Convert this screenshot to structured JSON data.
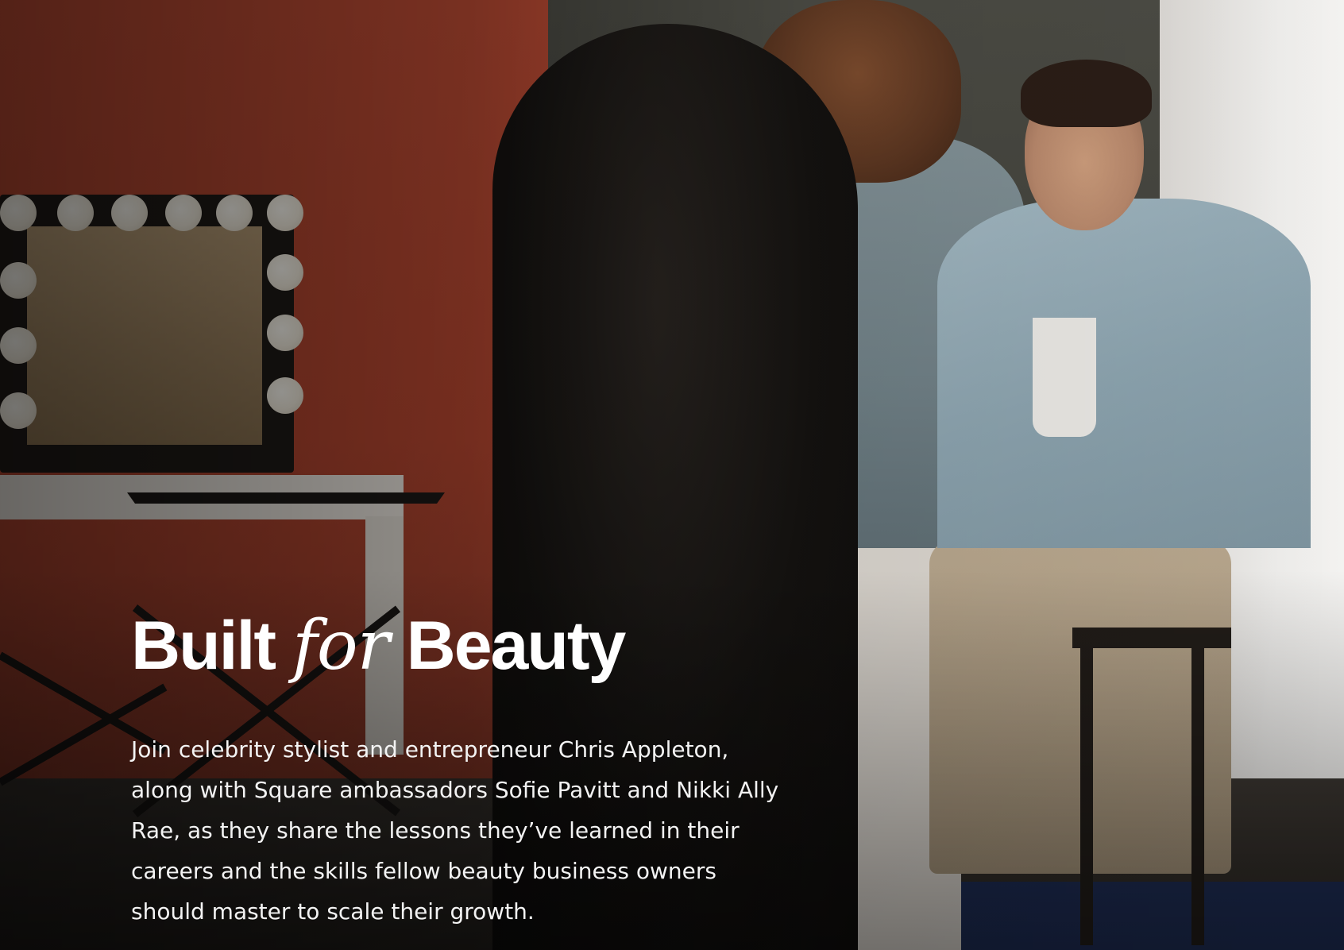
{
  "hero": {
    "headline_part1": "Built",
    "headline_part2": "for",
    "headline_part3": "Beauty",
    "body": "Join celebrity stylist and entrepreneur Chris Appleton, along with Square ambassadors Sofie Pavitt and Nikki Ally Rae, as they share the lessons they’ve learned in their careers and the skills fellow beauty business owners should master to scale their growth."
  },
  "colors": {
    "text": "#ffffff",
    "wall_accent": "#b94a33"
  }
}
